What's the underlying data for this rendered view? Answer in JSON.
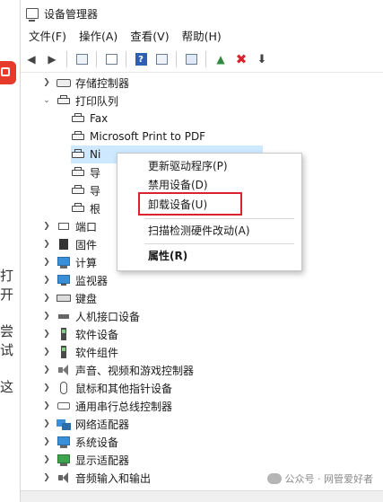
{
  "window": {
    "title": "设备管理器"
  },
  "menubar": {
    "items": [
      "文件(F)",
      "操作(A)",
      "查看(V)",
      "帮助(H)"
    ]
  },
  "toolbar": {
    "icons": [
      "back-arrow-icon",
      "forward-arrow-icon",
      "tree-view-icon",
      "properties-icon",
      "help-icon",
      "details-icon",
      "scan-hardware-icon",
      "update-driver-icon",
      "uninstall-icon",
      "disable-icon"
    ]
  },
  "left_strip": {
    "texts": [
      "打开",
      "尝试",
      "这"
    ]
  },
  "tree": {
    "storage": "存储控制器",
    "print_queue": "打印队列",
    "fax": "Fax",
    "ms_pdf": "Microsoft Print to PDF",
    "ms_xps_partial": "Ni",
    "hidden_1": "导",
    "hidden_2": "导",
    "hidden_3": "根",
    "ports_partial": "端口",
    "firmware_partial": "固件",
    "computer_partial": "计算",
    "monitor": "监视器",
    "keyboard": "键盘",
    "hid": "人机接口设备",
    "software_device": "软件设备",
    "software_component": "软件组件",
    "sound": "声音、视频和游戏控制器",
    "mouse": "鼠标和其他指针设备",
    "serial": "通用串行总线控制器",
    "network": "网络适配器",
    "system": "系统设备",
    "display": "显示适配器",
    "audio": "音频输入和输出"
  },
  "context_menu": {
    "update_driver": "更新驱动程序(P)",
    "disable": "禁用设备(D)",
    "uninstall": "卸载设备(U)",
    "scan": "扫描检测硬件改动(A)",
    "properties": "属性(R)"
  },
  "watermark": {
    "text": "公众号 · 网管爱好者"
  },
  "colors": {
    "highlight": "#d9232e",
    "selection": "#cde8ff"
  }
}
